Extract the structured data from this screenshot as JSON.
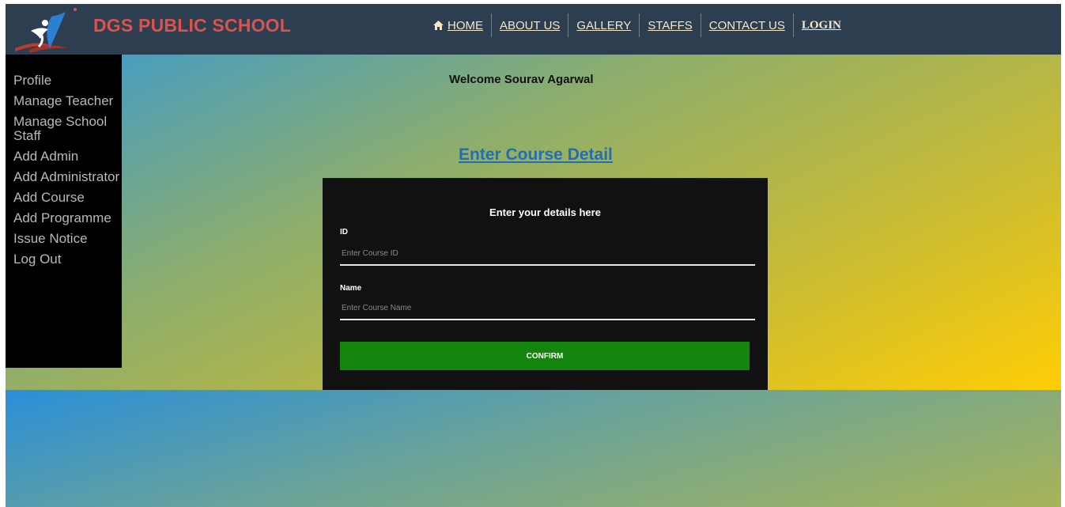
{
  "header": {
    "brand": "DGS PUBLIC SCHOOL",
    "nav": [
      {
        "label": "HOME",
        "icon": "home-icon"
      },
      {
        "label": "ABOUT US"
      },
      {
        "label": "GALLERY"
      },
      {
        "label": "STAFFS"
      },
      {
        "label": "CONTACT US"
      },
      {
        "label": "LOGIN"
      }
    ]
  },
  "sidebar": {
    "items": [
      {
        "label": "Profile"
      },
      {
        "label": "Manage Teacher"
      },
      {
        "label": "Manage School Staff"
      },
      {
        "label": "Add Admin"
      },
      {
        "label": "Add Administrator"
      },
      {
        "label": "Add Course"
      },
      {
        "label": "Add Programme"
      },
      {
        "label": "Issue Notice"
      },
      {
        "label": "Log Out"
      }
    ]
  },
  "main": {
    "welcome": "Welcome Sourav Agarwal",
    "heading": "Enter Course Detail"
  },
  "form": {
    "title": "Enter your details here",
    "id_label": "ID",
    "id_placeholder": "Enter Course ID",
    "id_value": "",
    "name_label": "Name",
    "name_placeholder": "Enter Course Name",
    "name_value": "",
    "confirm_label": "CONFIRM"
  },
  "colors": {
    "header_bg": "#2c3e50",
    "brand": "#d9534f",
    "nav_text": "#f5e6c8",
    "confirm_bg": "#13850c",
    "heading_link": "#1f6fb7"
  }
}
